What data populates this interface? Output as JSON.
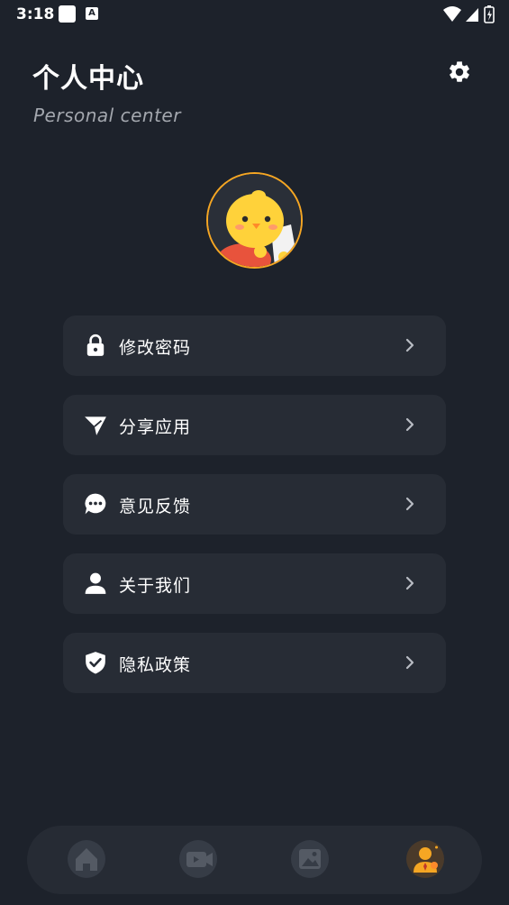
{
  "status": {
    "time": "3:18",
    "notif_letter": "A"
  },
  "header": {
    "title": "个人中心",
    "subtitle": "Personal center"
  },
  "menu": {
    "items": [
      {
        "label": "修改密码",
        "icon": "lock-icon"
      },
      {
        "label": "分享应用",
        "icon": "share-plane-icon"
      },
      {
        "label": "意见反馈",
        "icon": "chat-bubble-icon"
      },
      {
        "label": "关于我们",
        "icon": "person-icon"
      },
      {
        "label": "隐私政策",
        "icon": "shield-check-icon"
      }
    ]
  },
  "nav": {
    "items": [
      {
        "icon": "home-icon",
        "active": false
      },
      {
        "icon": "video-icon",
        "active": false
      },
      {
        "icon": "image-icon",
        "active": false
      },
      {
        "icon": "user-icon",
        "active": true
      }
    ]
  },
  "colors": {
    "background": "#1d222b",
    "card": "#272c35",
    "accent": "#f5a623",
    "muted": "#a3a7ae"
  }
}
